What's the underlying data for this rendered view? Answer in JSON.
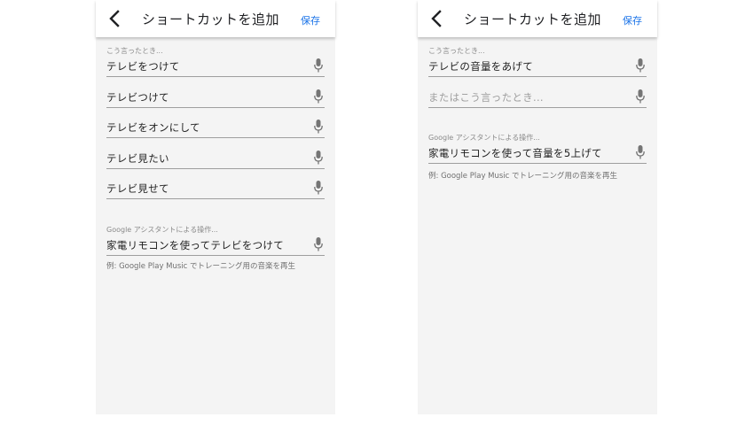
{
  "screens": [
    {
      "header": {
        "title": "ショートカットを追加",
        "save_label": "保存"
      },
      "when_label": "こう言ったとき...",
      "phrases": [
        {
          "text": "テレビをつけて",
          "placeholder": false
        },
        {
          "text": "テレビつけて",
          "placeholder": false
        },
        {
          "text": "テレビをオンにして",
          "placeholder": false
        },
        {
          "text": "テレビ見たい",
          "placeholder": false
        },
        {
          "text": "テレビ見せて",
          "placeholder": false
        }
      ],
      "action_label": "Google アシスタントによる操作...",
      "action_value": "家電リモコンを使ってテレビをつけて",
      "example": "例: Google Play Music でトレーニング用の音楽を再生"
    },
    {
      "header": {
        "title": "ショートカットを追加",
        "save_label": "保存"
      },
      "when_label": "こう言ったとき...",
      "phrases": [
        {
          "text": "テレビの音量をあげて",
          "placeholder": false
        },
        {
          "text": "またはこう言ったとき...",
          "placeholder": true
        }
      ],
      "action_label": "Google アシスタントによる操作...",
      "action_value": "家電リモコンを使って音量を5上げて",
      "example": "例: Google Play Music でトレーニング用の音楽を再生"
    }
  ],
  "icons": {
    "back": "arrow-back-icon",
    "mic": "microphone-icon"
  },
  "colors": {
    "accent": "#1a73e8",
    "background": "#f4f4f4",
    "underline": "#9e9e9e",
    "icon": "#757575"
  }
}
